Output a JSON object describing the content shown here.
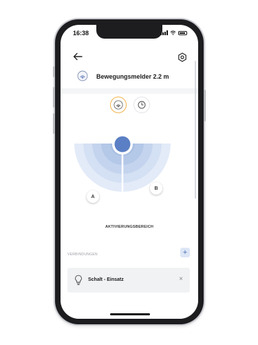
{
  "status_bar": {
    "time": "16:38"
  },
  "header": {
    "back_icon": "arrow-left-icon",
    "settings_icon": "gear-icon",
    "device_icon": "motion-sensor-icon",
    "title": "Bewegungsmelder 2.2 m"
  },
  "modes": [
    {
      "icon": "motion-sensor-icon",
      "active": true
    },
    {
      "icon": "clock-icon",
      "active": false
    }
  ],
  "detection": {
    "zone_a_label": "A",
    "zone_b_label": "B",
    "caption": "AKTIVIERUNGSBEREICH",
    "colors": {
      "sensor": "#5b7fc4",
      "ring_dark": "#a9bfe3",
      "ring_light": "#e3ebf8"
    }
  },
  "connections": {
    "section_label": "VERBINDUNGEN",
    "add_label": "+",
    "items": [
      {
        "label": "Schalt - Einsatz",
        "icon": "lightbulb-icon",
        "remove_label": "×"
      }
    ]
  },
  "colors": {
    "accent": "#f2b24a",
    "primary": "#4a6fb5"
  }
}
